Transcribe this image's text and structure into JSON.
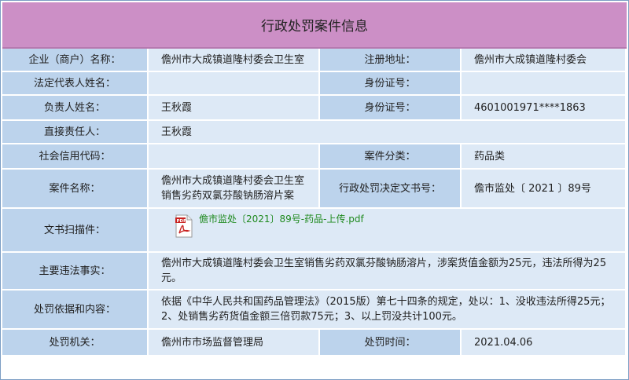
{
  "title": "行政处罚案件信息",
  "rows": {
    "r1": {
      "label1": "企业（商户）名称：",
      "value1": "儋州市大成镇道隆村委会卫生室",
      "label2": "注册地址：",
      "value2": "儋州市大成镇道隆村委会"
    },
    "r2": {
      "label1": "法定代表人姓名：",
      "value1": "",
      "label2": "身份证号：",
      "value2": ""
    },
    "r3": {
      "label1": "负责人姓名：",
      "value1": "王秋霞",
      "label2": "身份证号：",
      "value2": "4601001971****1863"
    },
    "r4": {
      "label1": "直接责任人：",
      "value1": "王秋霞"
    },
    "r5": {
      "label1": "社会信用代码：",
      "value1": "",
      "label2": "案件分类：",
      "value2": "药品类"
    },
    "r6": {
      "label1": "案件名称：",
      "value1": "儋州市大成镇道隆村委会卫生室销售劣药双氯芬酸钠肠溶片案",
      "label2": "行政处罚决定文书号：",
      "value2": "儋市监处〔 2021 〕89号"
    },
    "r7": {
      "label1": "文书扫描件：",
      "file_name": "儋市监处〔2021〕89号-药品-上传.pdf",
      "file_icon": "pdf-file-icon"
    },
    "r8": {
      "label1": "主要违法事实：",
      "value1": "儋州市大成镇道隆村委会卫生室销售劣药双氯芬酸钠肠溶片，涉案货值金额为25元，违法所得为25元。"
    },
    "r9": {
      "label1": "处罚依据和内容：",
      "value1": "依据《中华人民共和国药品管理法》（2015版）第七十四条的规定，处以：1、没收违法所得25元；2、处销售劣药货值金额三倍罚款75元；3、以上罚没共计100元。"
    },
    "r10": {
      "label1": "处罚机关：",
      "value1": "儋州市市场监督管理局",
      "label2": "处罚时间：",
      "value2": "2021.04.06"
    }
  },
  "colors": {
    "title_bg": "#cc8fc6",
    "label_bg": "#bcd3ec",
    "value_bg": "#dde9f6",
    "link": "#1f8a1f"
  }
}
